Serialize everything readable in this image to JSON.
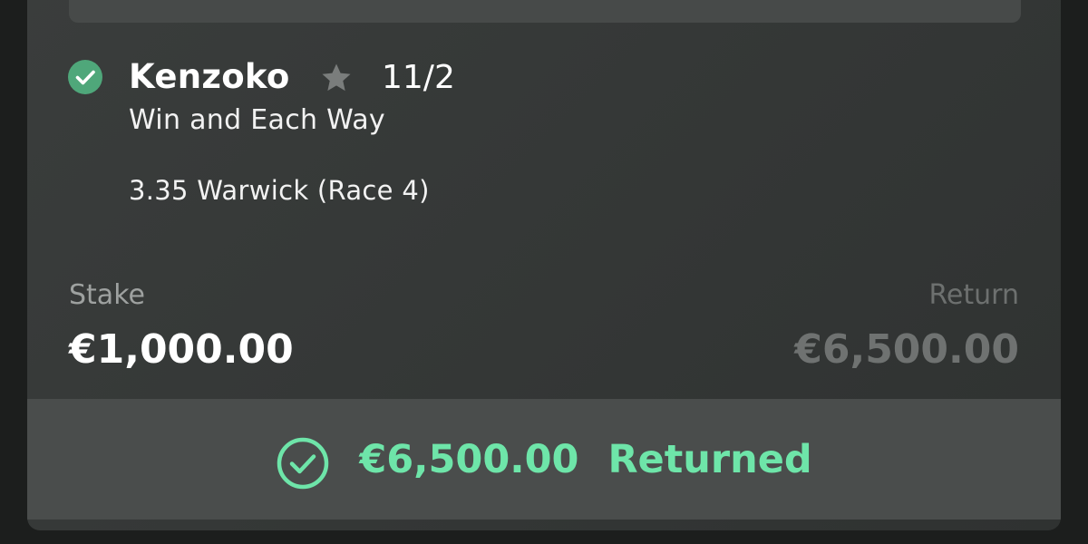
{
  "bet": {
    "selection": "Kenzoko",
    "odds": "11/2",
    "market": "Win and Each Way",
    "race": "3.35 Warwick (Race 4)"
  },
  "stake": {
    "label": "Stake",
    "value": "€1,000.00"
  },
  "return": {
    "label": "Return",
    "value": "€6,500.00"
  },
  "result": {
    "amount": "€6,500.00",
    "label": "Returned"
  },
  "colors": {
    "accent": "#6ee5a9",
    "check_badge": "#4fa77a",
    "card_bg": "#363938",
    "footer_bg": "#4a4d4c"
  },
  "icons": {
    "settled": "check-circle-icon",
    "favourite": "star-icon",
    "returned": "check-circle-outline-icon"
  }
}
